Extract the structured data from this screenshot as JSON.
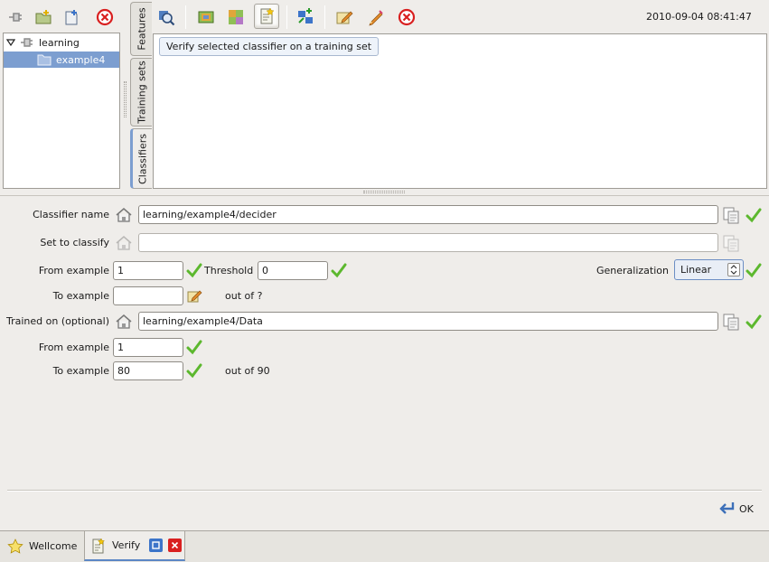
{
  "toolbar_left": {
    "icons": [
      "disconnect-icon",
      "new-folder-icon",
      "new-file-icon",
      "delete-icon"
    ]
  },
  "tree": {
    "root_label": "learning",
    "child_label": "example4"
  },
  "vertical_tabs": {
    "features": "Features",
    "training_sets": "Training sets",
    "classifiers": "Classifiers"
  },
  "toolbar_main": {
    "icons": [
      "search-classifier-icon",
      "train-icon",
      "classify-icon",
      "verify-icon",
      "import-icon",
      "edit-icon",
      "pencil-icon",
      "delete-icon"
    ],
    "tooltip": "Verify selected classifier on a training set",
    "timestamp": "2010-09-04 08:41:47"
  },
  "form": {
    "classifier_name_label": "Classifier name",
    "classifier_name_value": "learning/example4/decider",
    "set_to_classify_label": "Set to classify",
    "set_to_classify_value": "",
    "from_example_label": "From example",
    "from_example_value": "1",
    "threshold_label": "Threshold",
    "threshold_value": "0",
    "generalization_label": "Generalization",
    "generalization_value": "Linear",
    "to_example_label": "To example",
    "to_example_value": "",
    "out_of_label": "out of ?",
    "trained_on_label": "Trained on (optional)",
    "trained_on_value": "learning/example4/Data",
    "trained_from_label": "From example",
    "trained_from_value": "1",
    "trained_to_label": "To example",
    "trained_to_value": "80",
    "trained_out_of_label": "out of 90"
  },
  "ok_label": "OK",
  "bottom_tabs": {
    "welcome": "Wellcome",
    "verify": "Verify"
  },
  "colors": {
    "selection": "#7c9ed0",
    "check": "#5cb82e",
    "close": "#d92020"
  }
}
